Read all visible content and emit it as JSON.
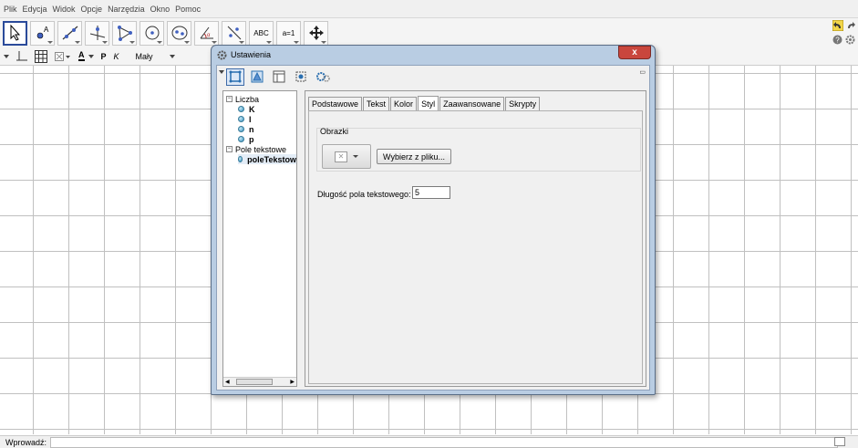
{
  "menubar": {
    "items": [
      "Plik",
      "Edycja",
      "Widok",
      "Opcje",
      "Narzędzia",
      "Okno",
      "Pomoc"
    ]
  },
  "toolbar": {
    "tools": [
      {
        "name": "move-tool",
        "icon": "arrow-pointer-icon"
      },
      {
        "name": "point-tool",
        "icon": "point-icon",
        "glyph": "A"
      },
      {
        "name": "line-tool",
        "icon": "line-icon"
      },
      {
        "name": "perpendicular-tool",
        "icon": "perpendicular-icon"
      },
      {
        "name": "polygon-tool",
        "icon": "polygon-icon"
      },
      {
        "name": "circle-tool",
        "icon": "circle-icon"
      },
      {
        "name": "ellipse-tool",
        "icon": "ellipse-icon"
      },
      {
        "name": "angle-tool",
        "icon": "angle-icon"
      },
      {
        "name": "reflect-tool",
        "icon": "reflect-icon"
      },
      {
        "name": "text-tool",
        "icon": "text-icon",
        "glyph": "ABC"
      },
      {
        "name": "slider-tool",
        "icon": "slider-icon",
        "glyph": "a=1"
      },
      {
        "name": "move-view-tool",
        "icon": "move-view-icon"
      }
    ]
  },
  "stylebar": {
    "font_size": "Mały",
    "bold": "P",
    "italic": "K",
    "text_color_glyph": "A"
  },
  "dialog": {
    "title": "Ustawienia",
    "close": "x",
    "tree": {
      "groups": [
        {
          "label": "Liczba",
          "items": [
            "K",
            "l",
            "n",
            "p"
          ]
        },
        {
          "label": "Pole tekstowe",
          "items": [
            "poleTekstow"
          ]
        }
      ]
    },
    "tabs": [
      "Podstawowe",
      "Tekst",
      "Kolor",
      "Styl",
      "Zaawansowane",
      "Skrypty"
    ],
    "active_tab": "Styl",
    "style": {
      "images_group_title": "Obrazki",
      "choose_file_label": "Wybierz z pliku...",
      "length_label": "Długość pola tekstowego:",
      "length_value": "5"
    }
  },
  "inputbar": {
    "label": "Wprowadź:"
  },
  "colors": {
    "dialog_frame": "#b9cde3",
    "close": "#c9463d",
    "grid": "#c0c0c0"
  }
}
